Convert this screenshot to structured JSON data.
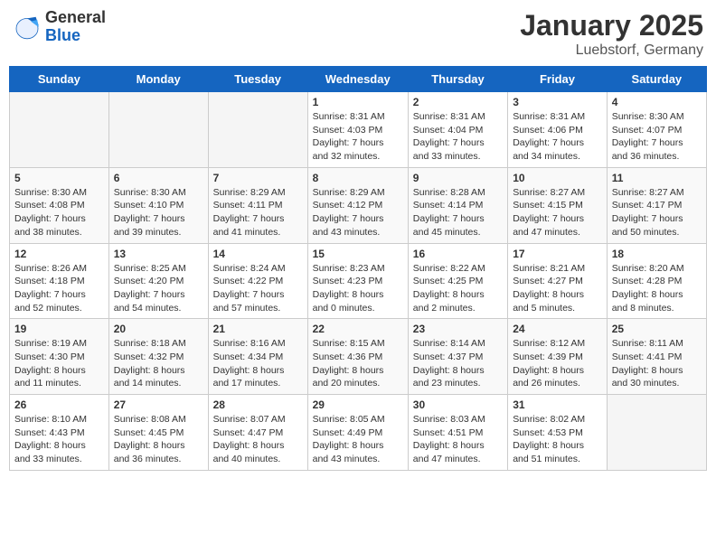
{
  "header": {
    "logo_general": "General",
    "logo_blue": "Blue",
    "month_title": "January 2025",
    "location": "Luebstorf, Germany"
  },
  "weekdays": [
    "Sunday",
    "Monday",
    "Tuesday",
    "Wednesday",
    "Thursday",
    "Friday",
    "Saturday"
  ],
  "weeks": [
    [
      {
        "day": "",
        "info": ""
      },
      {
        "day": "",
        "info": ""
      },
      {
        "day": "",
        "info": ""
      },
      {
        "day": "1",
        "info": "Sunrise: 8:31 AM\nSunset: 4:03 PM\nDaylight: 7 hours\nand 32 minutes."
      },
      {
        "day": "2",
        "info": "Sunrise: 8:31 AM\nSunset: 4:04 PM\nDaylight: 7 hours\nand 33 minutes."
      },
      {
        "day": "3",
        "info": "Sunrise: 8:31 AM\nSunset: 4:06 PM\nDaylight: 7 hours\nand 34 minutes."
      },
      {
        "day": "4",
        "info": "Sunrise: 8:30 AM\nSunset: 4:07 PM\nDaylight: 7 hours\nand 36 minutes."
      }
    ],
    [
      {
        "day": "5",
        "info": "Sunrise: 8:30 AM\nSunset: 4:08 PM\nDaylight: 7 hours\nand 38 minutes."
      },
      {
        "day": "6",
        "info": "Sunrise: 8:30 AM\nSunset: 4:10 PM\nDaylight: 7 hours\nand 39 minutes."
      },
      {
        "day": "7",
        "info": "Sunrise: 8:29 AM\nSunset: 4:11 PM\nDaylight: 7 hours\nand 41 minutes."
      },
      {
        "day": "8",
        "info": "Sunrise: 8:29 AM\nSunset: 4:12 PM\nDaylight: 7 hours\nand 43 minutes."
      },
      {
        "day": "9",
        "info": "Sunrise: 8:28 AM\nSunset: 4:14 PM\nDaylight: 7 hours\nand 45 minutes."
      },
      {
        "day": "10",
        "info": "Sunrise: 8:27 AM\nSunset: 4:15 PM\nDaylight: 7 hours\nand 47 minutes."
      },
      {
        "day": "11",
        "info": "Sunrise: 8:27 AM\nSunset: 4:17 PM\nDaylight: 7 hours\nand 50 minutes."
      }
    ],
    [
      {
        "day": "12",
        "info": "Sunrise: 8:26 AM\nSunset: 4:18 PM\nDaylight: 7 hours\nand 52 minutes."
      },
      {
        "day": "13",
        "info": "Sunrise: 8:25 AM\nSunset: 4:20 PM\nDaylight: 7 hours\nand 54 minutes."
      },
      {
        "day": "14",
        "info": "Sunrise: 8:24 AM\nSunset: 4:22 PM\nDaylight: 7 hours\nand 57 minutes."
      },
      {
        "day": "15",
        "info": "Sunrise: 8:23 AM\nSunset: 4:23 PM\nDaylight: 8 hours\nand 0 minutes."
      },
      {
        "day": "16",
        "info": "Sunrise: 8:22 AM\nSunset: 4:25 PM\nDaylight: 8 hours\nand 2 minutes."
      },
      {
        "day": "17",
        "info": "Sunrise: 8:21 AM\nSunset: 4:27 PM\nDaylight: 8 hours\nand 5 minutes."
      },
      {
        "day": "18",
        "info": "Sunrise: 8:20 AM\nSunset: 4:28 PM\nDaylight: 8 hours\nand 8 minutes."
      }
    ],
    [
      {
        "day": "19",
        "info": "Sunrise: 8:19 AM\nSunset: 4:30 PM\nDaylight: 8 hours\nand 11 minutes."
      },
      {
        "day": "20",
        "info": "Sunrise: 8:18 AM\nSunset: 4:32 PM\nDaylight: 8 hours\nand 14 minutes."
      },
      {
        "day": "21",
        "info": "Sunrise: 8:16 AM\nSunset: 4:34 PM\nDaylight: 8 hours\nand 17 minutes."
      },
      {
        "day": "22",
        "info": "Sunrise: 8:15 AM\nSunset: 4:36 PM\nDaylight: 8 hours\nand 20 minutes."
      },
      {
        "day": "23",
        "info": "Sunrise: 8:14 AM\nSunset: 4:37 PM\nDaylight: 8 hours\nand 23 minutes."
      },
      {
        "day": "24",
        "info": "Sunrise: 8:12 AM\nSunset: 4:39 PM\nDaylight: 8 hours\nand 26 minutes."
      },
      {
        "day": "25",
        "info": "Sunrise: 8:11 AM\nSunset: 4:41 PM\nDaylight: 8 hours\nand 30 minutes."
      }
    ],
    [
      {
        "day": "26",
        "info": "Sunrise: 8:10 AM\nSunset: 4:43 PM\nDaylight: 8 hours\nand 33 minutes."
      },
      {
        "day": "27",
        "info": "Sunrise: 8:08 AM\nSunset: 4:45 PM\nDaylight: 8 hours\nand 36 minutes."
      },
      {
        "day": "28",
        "info": "Sunrise: 8:07 AM\nSunset: 4:47 PM\nDaylight: 8 hours\nand 40 minutes."
      },
      {
        "day": "29",
        "info": "Sunrise: 8:05 AM\nSunset: 4:49 PM\nDaylight: 8 hours\nand 43 minutes."
      },
      {
        "day": "30",
        "info": "Sunrise: 8:03 AM\nSunset: 4:51 PM\nDaylight: 8 hours\nand 47 minutes."
      },
      {
        "day": "31",
        "info": "Sunrise: 8:02 AM\nSunset: 4:53 PM\nDaylight: 8 hours\nand 51 minutes."
      },
      {
        "day": "",
        "info": ""
      }
    ]
  ]
}
